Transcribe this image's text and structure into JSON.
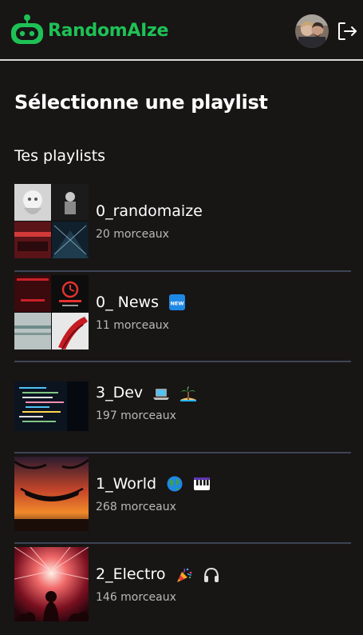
{
  "header": {
    "logo_text": "RandomAIze",
    "brand_color": "#1ec155",
    "avatar_icon": "user-avatar",
    "logout_icon": "logout-icon"
  },
  "page": {
    "title": "Sélectionne une playlist",
    "section_title": "Tes playlists"
  },
  "playlists": [
    {
      "name": "0_randomaize",
      "count": "20 morceaux",
      "emojis": []
    },
    {
      "name": "0_ News",
      "count": "11 morceaux",
      "emojis": [
        "new-button-emoji"
      ]
    },
    {
      "name": "3_Dev",
      "count": "197 morceaux",
      "emojis": [
        "laptop-emoji",
        "island-emoji"
      ]
    },
    {
      "name": "1_World",
      "count": "268 morceaux",
      "emojis": [
        "globe-emoji",
        "piano-emoji"
      ]
    },
    {
      "name": "2_Electro",
      "count": "146 morceaux",
      "emojis": [
        "party-popper-emoji",
        "headphones-emoji"
      ]
    }
  ]
}
